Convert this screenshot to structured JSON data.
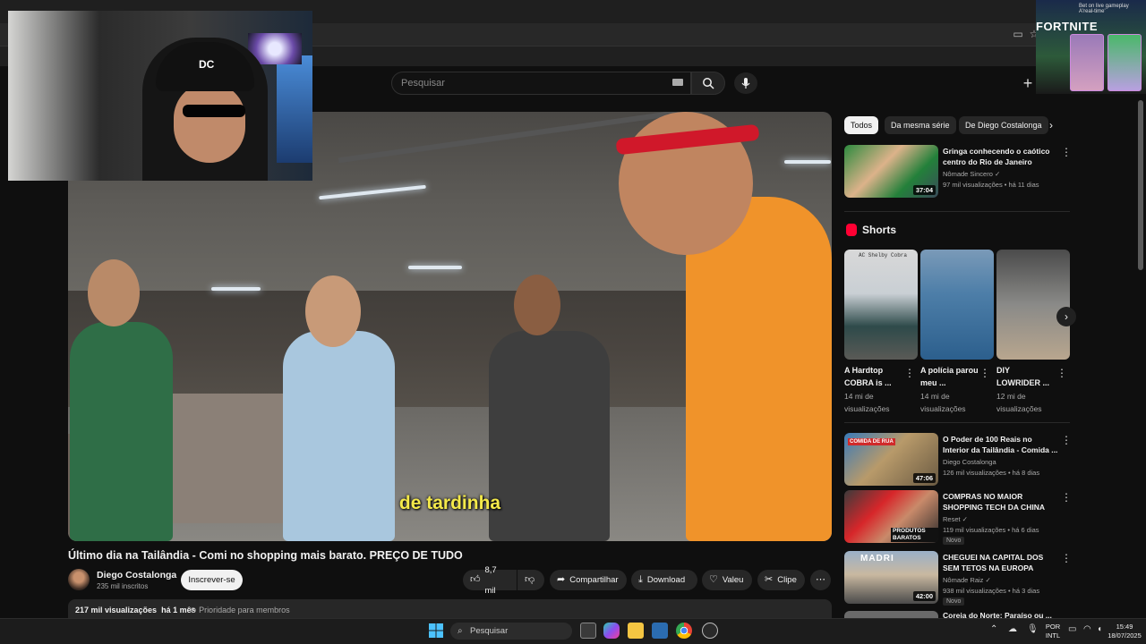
{
  "search": {
    "placeholder": "Pesquisar"
  },
  "header": {
    "create_icon": "plus-icon"
  },
  "video": {
    "subtitle": "de tardinha",
    "title": "Último dia na Tailândia - Comi no shopping mais barato. PREÇO DE TUDO",
    "channel": "Diego Costalonga",
    "subscribers": "235 mil inscritos",
    "subscribe_label": "Inscrever-se",
    "likes": "8,7 mil",
    "share_label": "Compartilhar",
    "download_label": "Download",
    "thanks_label": "Valeu",
    "clip_label": "Clipe",
    "views": "217 mil visualizações",
    "age": "há 1 mês",
    "priority": "Prioridade para membros"
  },
  "chips": [
    "Todos",
    "Da mesma série",
    "De Diego Costalonga"
  ],
  "recommendations_top": [
    {
      "title": "Gringa conhecendo o caótico centro do Rio de Janeiro",
      "channel": "Nômade Sincero ✓",
      "meta": "97 mil visualizações • há 11 dias",
      "duration": "37:04"
    }
  ],
  "shorts": {
    "title": "Shorts",
    "items": [
      {
        "title": "A Hardtop COBRA is ...",
        "views": "14 mi de visualizações",
        "thumb_text": "AC Shelby Cobra"
      },
      {
        "title": "A polícia parou meu ...",
        "views": "14 mi de visualizações"
      },
      {
        "title": "DIY LOWRIDER ...",
        "views": "12 mi de visualizações"
      }
    ]
  },
  "recommendations": [
    {
      "title": "O Poder de 100 Reais no Interior da Tailândia - Comida ...",
      "channel": "Diego Costalonga",
      "meta": "126 mil visualizações • há 8 dias",
      "duration": "47:06",
      "badge": "",
      "thumb_text": "COMIDA DE RUA"
    },
    {
      "title": "COMPRAS NO MAIOR SHOPPING TECH DA CHINA",
      "channel": "Reset ✓",
      "meta": "119 mil visualizações • há 6 dias",
      "duration": "",
      "badge": "Novo",
      "thumb_text": "PRODUTOS BARATOS"
    },
    {
      "title": "CHEGUEI NA CAPITAL DOS SEM TETOS NA EUROPA",
      "channel": "Nômade Raiz ✓",
      "meta": "938 mil visualizações • há 3 dias",
      "duration": "42:00",
      "badge": "Novo",
      "thumb_text": "MADRI"
    },
    {
      "title": "Coreia do Norte: Paraíso ou ...",
      "channel": "",
      "meta": "",
      "duration": "",
      "badge": ""
    }
  ],
  "webcam_cap_text": "DC",
  "overlay": {
    "brand": "FORTNITE",
    "ad_line1": "Bet on live gameplay",
    "ad_line2": "A'real-time'"
  },
  "taskbar": {
    "search_placeholder": "Pesquisar",
    "lang_line1": "POR",
    "lang_line2": "INTL",
    "time": "15:49",
    "date": "18/07/2025"
  },
  "colors": {
    "accent": "#ff0033",
    "subtitle": "#f4e94a",
    "background": "#0f0f0f"
  }
}
